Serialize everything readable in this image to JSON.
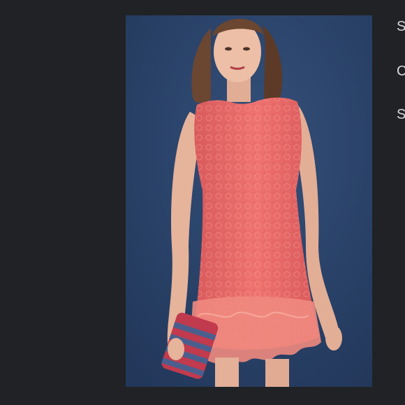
{
  "photo": {
    "alt": "",
    "colors": {
      "backdrop": "#2b4468",
      "dress": "#e96a68",
      "lace_hem": "#f0887f",
      "skin": "#e8b79f",
      "hair": "#6b4631",
      "clutch_red": "#c23a4d",
      "clutch_blue": "#4b5f8e"
    }
  },
  "side_text": [
    {
      "text": "S"
    },
    {
      "text": "C"
    },
    {
      "text": "S"
    }
  ]
}
